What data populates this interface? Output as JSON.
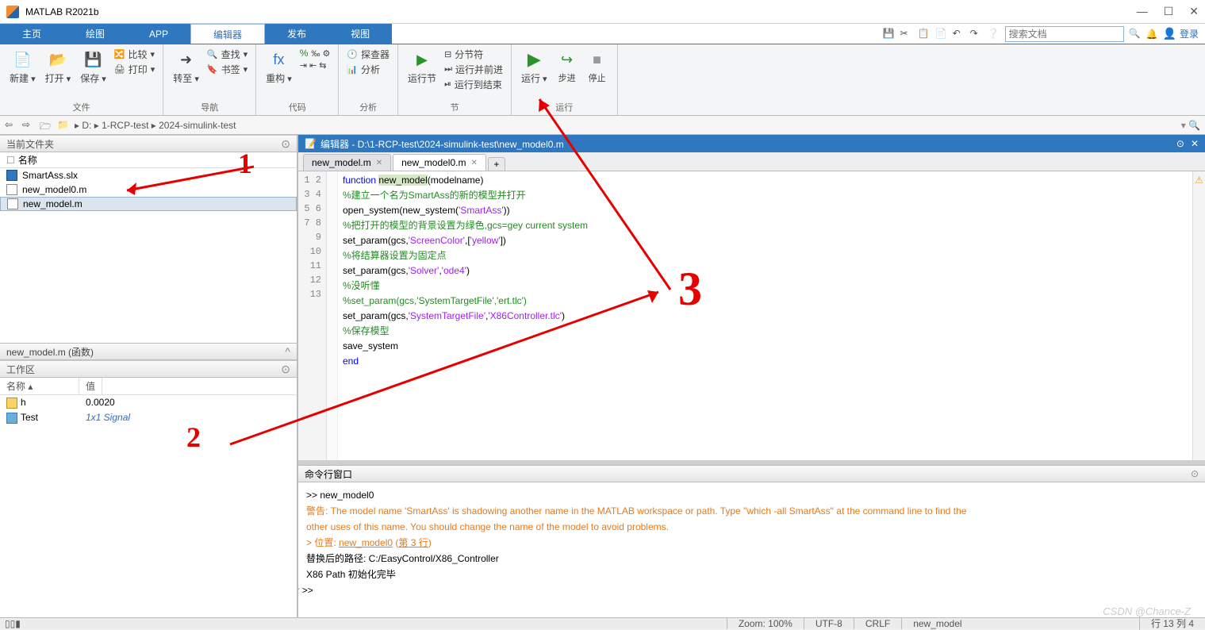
{
  "app": {
    "title": "MATLAB R2021b"
  },
  "win": {
    "min": "—",
    "max": "☐",
    "close": "✕"
  },
  "ribbon": {
    "tabs": [
      "主页",
      "绘图",
      "APP",
      "编辑器",
      "发布",
      "视图"
    ],
    "active": 3,
    "search_ph": "搜索文档",
    "login": "登录"
  },
  "toolstrip": {
    "g0": {
      "name": "文件",
      "new": "新建",
      "open": "打开",
      "save": "保存",
      "compare": "比较",
      "print": "打印"
    },
    "g1": {
      "name": "导航",
      "goto": "转至",
      "find": "查找",
      "bookmark": "书签"
    },
    "g2": {
      "name": "代码",
      "refactor": "重构",
      "analyze": "分析"
    },
    "g3": {
      "name": "节",
      "explore": "探查器",
      "runsec": "运行节",
      "split": "分节符",
      "runadv": "运行并前进",
      "runend": "运行到结束"
    },
    "g4": {
      "name": "运行",
      "run": "运行",
      "step": "步进",
      "stop": "停止"
    }
  },
  "addr": {
    "drive": "D:",
    "p1": "1-RCP-test",
    "p2": "2024-simulink-test"
  },
  "westpanels": {
    "files_title": "当前文件夹",
    "name_hdr": "名称",
    "f1": "SmartAss.slx",
    "f2": "new_model0.m",
    "f3": "new_model.m",
    "sub_title": "new_model.m (函数)",
    "ws_title": "工作区",
    "ws_name": "名称",
    "ws_val": "值",
    "w1n": "h",
    "w1v": "0.0020",
    "w2n": "Test",
    "w2v": "1x1 Signal"
  },
  "editor": {
    "title": "编辑器 - D:\\1-RCP-test\\2024-simulink-test\\new_model0.m",
    "tab1": "new_model.m",
    "tab2": "new_model0.m",
    "lines": {
      "l1a": "function ",
      "l1b": "new_model",
      "l1c": "(modelname)",
      "l2": "%建立一个名为SmartAss的新的模型并打开",
      "l3a": "open_system(new_system(",
      "l3b": "'SmartAss'",
      "l3c": "))",
      "l4": "%把打开的模型的背景设置为绿色,gcs=gey current system",
      "l5a": "set_param(gcs,",
      "l5b": "'ScreenColor'",
      "l5c": ",[",
      "l5d": "'yellow'",
      "l5e": "])",
      "l6": "%将结算器设置为固定点",
      "l7a": "set_param(gcs,",
      "l7b": "'Solver'",
      "l7c": ",",
      "l7d": "'ode4'",
      "l7e": ")",
      "l8": "%没听懂",
      "l9": "%set_param(gcs,'SystemTargetFile','ert.tlc')",
      "l10a": "set_param(gcs,",
      "l10b": "'SystemTargetFile'",
      "l10c": ",",
      "l10d": "'X86Controller.tlc'",
      "l10e": ")",
      "l11": "%保存模型",
      "l12": "save_system",
      "l13": "end"
    }
  },
  "cmd": {
    "title": "命令行窗口",
    "l1": ">> new_model0",
    "l2": "警告: The model name 'SmartAss' is shadowing another name in the MATLAB workspace or path. Type \"which -all SmartAss\" at the command line to find the",
    "l3": "other uses of this name. You should change the name of the model to avoid problems.",
    "l4a": "> 位置: ",
    "l4b": "new_model0",
    "l4c": " (",
    "l4d": "第 3 行",
    "l4e": ")",
    "l5": "替换后的路径: C:/EasyControl/X86_Controller",
    "l6": "X86 Path 初始化完毕",
    "prompt": ">> "
  },
  "status": {
    "zoom": "Zoom: 100%",
    "enc": "UTF-8",
    "eol": "CRLF",
    "fn": "new_model",
    "pos": "行 13    列 4"
  },
  "watermark": "CSDN @Chance-Z"
}
